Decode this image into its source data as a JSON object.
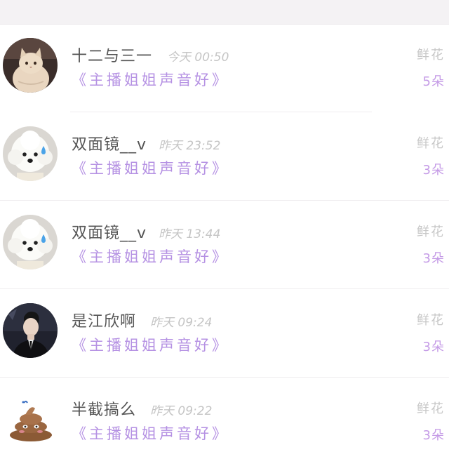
{
  "messages": [
    {
      "avatar": "cat-avatar",
      "name": "十二与三一",
      "time": "今天 00:50",
      "text": "《主播姐姐声音好》",
      "gift_label": "鲜花",
      "gift_count": "5朵"
    },
    {
      "avatar": "white-dog-avatar",
      "name": "双面镜__v",
      "time": "昨天 23:52",
      "text": "《主播姐姐声音好》",
      "gift_label": "鲜花",
      "gift_count": "3朵"
    },
    {
      "avatar": "white-dog-avatar",
      "name": "双面镜__v",
      "time": "昨天 13:44",
      "text": "《主播姐姐声音好》",
      "gift_label": "鲜花",
      "gift_count": "3朵"
    },
    {
      "avatar": "man-portrait-avatar",
      "name": "是江欣啊",
      "time": "昨天 09:24",
      "text": "《主播姐姐声音好》",
      "gift_label": "鲜花",
      "gift_count": "3朵"
    },
    {
      "avatar": "poop-avatar",
      "name": "半截搞么",
      "time": "昨天 09:22",
      "text": "《主播姐姐声音好》",
      "gift_label": "鲜花",
      "gift_count": "3朵"
    }
  ]
}
